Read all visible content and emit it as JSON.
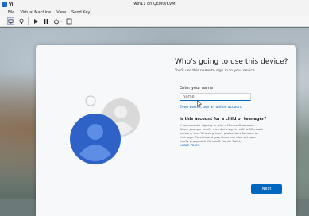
{
  "window": {
    "app_abbrev": "Vi",
    "title": "win11 on QEMU/KVM"
  },
  "menu": [
    "File",
    "Virtual Machine",
    "View",
    "Send Key"
  ],
  "toolbar": {
    "buttons": [
      "screen-icon",
      "lightbulb-icon",
      "play-icon",
      "pause-icon",
      "power-icon",
      "fullscreen-icon"
    ]
  },
  "oobe": {
    "heading": "Who's going to use this device?",
    "subtext": "You'll use this name to sign in to your device.",
    "name_label": "Enter your name",
    "name_placeholder": "Name",
    "online_link": "Even better, use an online account",
    "child_heading": "Is this account for a child or teenager?",
    "child_body": "If so, consider signing in with a Microsoft account. When younger family members sign in with a Microsoft account, they'll have privacy protections focused on their age. Parents and guardians can also set up a family group with Microsoft Family Safety.",
    "learn_more": "Learn more",
    "next": "Next"
  },
  "colors": {
    "accent": "#0067c0",
    "link": "#005fb8",
    "avatar_front": "#2f62c7",
    "avatar_back": "#d6d6d6"
  }
}
